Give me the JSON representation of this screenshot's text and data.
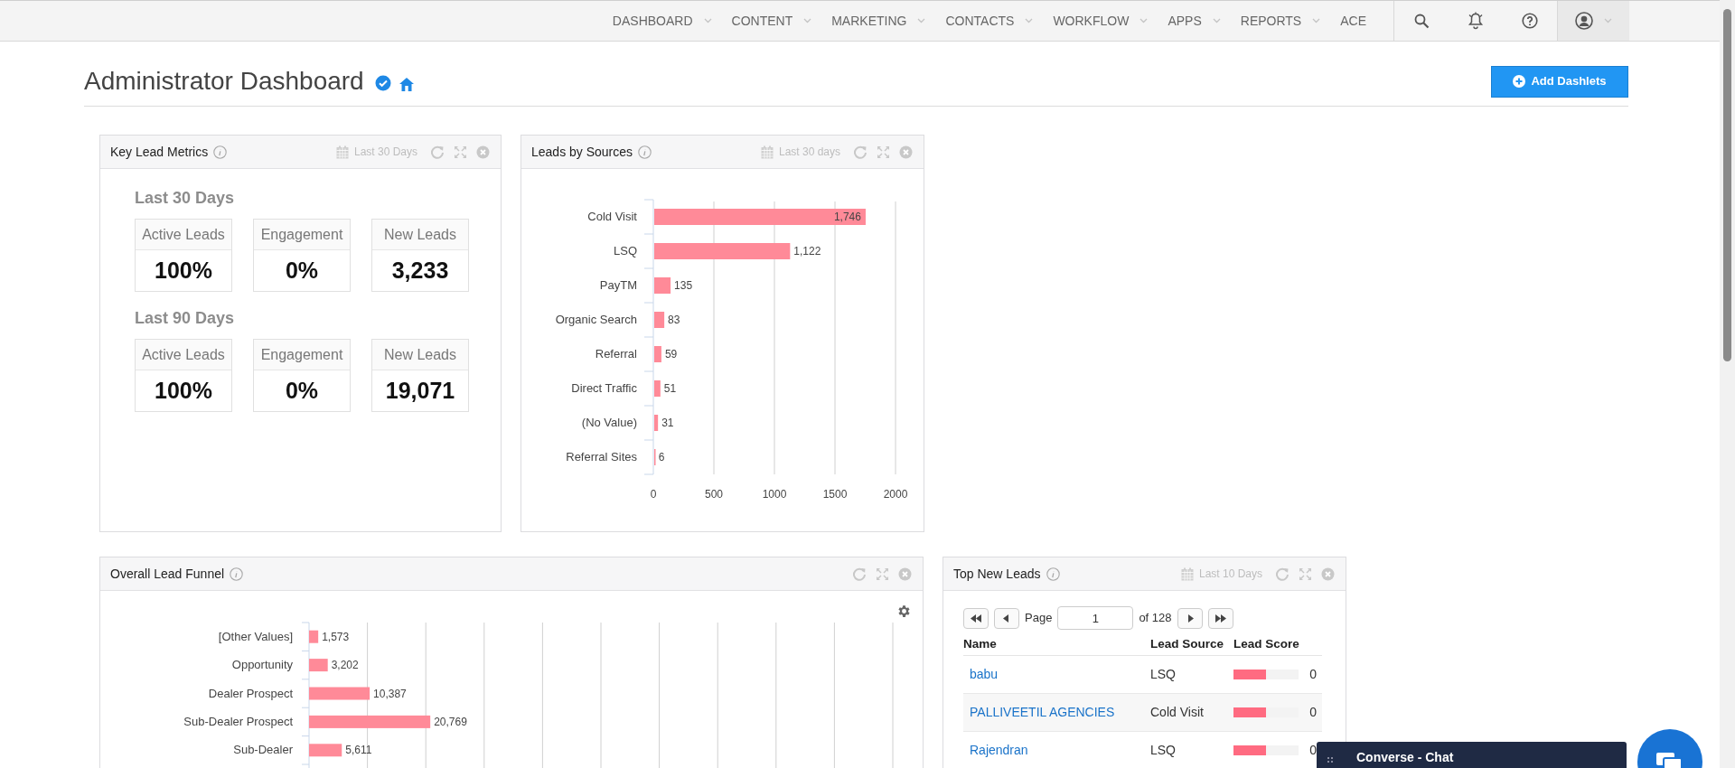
{
  "nav": {
    "items": [
      {
        "label": "DASHBOARD",
        "dropdown": true
      },
      {
        "label": "CONTENT",
        "dropdown": true
      },
      {
        "label": "MARKETING",
        "dropdown": true
      },
      {
        "label": "CONTACTS",
        "dropdown": true
      },
      {
        "label": "WORKFLOW",
        "dropdown": true
      },
      {
        "label": "APPS",
        "dropdown": true
      },
      {
        "label": "REPORTS",
        "dropdown": true
      },
      {
        "label": "ACE",
        "dropdown": false
      }
    ]
  },
  "page": {
    "title": "Administrator Dashboard",
    "add_button": "Add Dashlets"
  },
  "key_lead_metrics": {
    "title": "Key Lead Metrics",
    "date_range": "Last 30 Days",
    "sections": [
      {
        "heading": "Last 30 Days",
        "metrics": [
          {
            "label": "Active Leads",
            "value": "100%"
          },
          {
            "label": "Engagement",
            "value": "0%"
          },
          {
            "label": "New Leads",
            "value": "3,233"
          }
        ]
      },
      {
        "heading": "Last 90 Days",
        "metrics": [
          {
            "label": "Active Leads",
            "value": "100%"
          },
          {
            "label": "Engagement",
            "value": "0%"
          },
          {
            "label": "New Leads",
            "value": "19,071"
          }
        ]
      }
    ]
  },
  "leads_by_sources": {
    "title": "Leads by Sources",
    "date_range": "Last 30 days",
    "chart_data": {
      "type": "bar",
      "orientation": "horizontal",
      "categories": [
        "Cold Visit",
        "LSQ",
        "PayTM",
        "Organic Search",
        "Referral",
        "Direct Traffic",
        "(No Value)",
        "Referral Sites"
      ],
      "values": [
        1746,
        1122,
        135,
        83,
        59,
        51,
        31,
        6
      ],
      "value_labels": [
        "1,746",
        "1,122",
        "135",
        "83",
        "59",
        "51",
        "31",
        "6"
      ],
      "xlim": [
        0,
        2000
      ],
      "xticks": [
        0,
        500,
        1000,
        1500,
        2000
      ],
      "grid": true
    }
  },
  "lead_funnel": {
    "title": "Overall Lead Funnel",
    "chart_data": {
      "type": "bar",
      "orientation": "horizontal",
      "categories": [
        "[Other Values]",
        "Opportunity",
        "Dealer Prospect",
        "Sub-Dealer Prospect",
        "Sub-Dealer"
      ],
      "values": [
        1573,
        3202,
        10387,
        20769,
        5611
      ],
      "value_labels": [
        "1,573",
        "3,202",
        "10,387",
        "20,769",
        "5,611"
      ],
      "xlim": [
        0,
        100000
      ],
      "grid": true
    }
  },
  "top_new_leads": {
    "title": "Top New Leads",
    "date_range": "Last 10 Days",
    "pager": {
      "page_label": "Page",
      "page_value": "1",
      "of_label": "of 128"
    },
    "columns": [
      "Name",
      "Lead Source",
      "Lead Score"
    ],
    "rows": [
      {
        "name": "babu",
        "source": "LSQ",
        "score": "0",
        "level": 0.5
      },
      {
        "name": "PALLIVEETIL AGENCIES",
        "source": "Cold Visit",
        "score": "0",
        "level": 0.5
      },
      {
        "name": "Rajendran",
        "source": "LSQ",
        "score": "0",
        "level": 0.5
      }
    ]
  },
  "chat": {
    "title": "Converse - Chat"
  }
}
